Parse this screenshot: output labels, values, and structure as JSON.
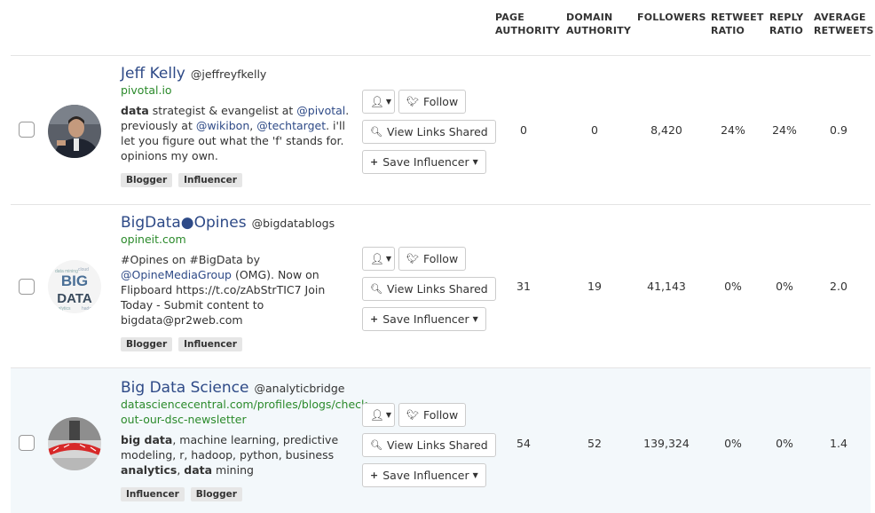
{
  "columns": {
    "page_authority": [
      "PAGE",
      "AUTHORITY"
    ],
    "domain_authority": [
      "DOMAIN",
      "AUTHORITY"
    ],
    "followers": [
      "FOLLOWERS"
    ],
    "retweet_ratio": [
      "RETWEET",
      "RATIO"
    ],
    "reply_ratio": [
      "REPLY",
      "RATIO"
    ],
    "average_retweets": [
      "AVERAGE",
      "RETWEETS"
    ]
  },
  "buttons": {
    "follow": "Follow",
    "view_links": "View Links Shared",
    "save": "Save Influencer"
  },
  "influencers": [
    {
      "name": "Jeff Kelly",
      "handle": "@jeffreyfkelly",
      "site": [
        "pivotal.io"
      ],
      "bio": [
        [
          {
            "t": "data",
            "b": true
          },
          {
            "t": " strategist & evangelist at "
          },
          {
            "t": "@pivotal",
            "m": true
          },
          {
            "t": "."
          }
        ],
        [
          {
            "t": "previously at "
          },
          {
            "t": "@wikibon",
            "m": true
          },
          {
            "t": ", "
          },
          {
            "t": "@techtarget",
            "m": true
          },
          {
            "t": ". i'll"
          }
        ],
        [
          {
            "t": "let you figure out what the 'f' stands for."
          }
        ],
        [
          {
            "t": "opinions my own."
          }
        ]
      ],
      "tags": [
        "Blogger",
        "Influencer"
      ],
      "page_authority": "0",
      "domain_authority": "0",
      "followers": "8,420",
      "retweet_ratio": "24%",
      "reply_ratio": "24%",
      "average_retweets": "0.9"
    },
    {
      "name": "BigData●Opines",
      "handle": "@bigdatablogs",
      "site": [
        "opineit.com"
      ],
      "bio": [
        [
          {
            "t": "#Opines on #BigData by"
          }
        ],
        [
          {
            "t": "@OpineMediaGroup",
            "m": true
          },
          {
            "t": " (OMG). Now on"
          }
        ],
        [
          {
            "t": "Flipboard https://t.co/zAbStrTIC7 Join"
          }
        ],
        [
          {
            "t": "Today - Submit content to"
          }
        ],
        [
          {
            "t": "bigdata@pr2web.com"
          }
        ]
      ],
      "tags": [
        "Blogger",
        "Influencer"
      ],
      "page_authority": "31",
      "domain_authority": "19",
      "followers": "41,143",
      "retweet_ratio": "0%",
      "reply_ratio": "0%",
      "average_retweets": "2.0"
    },
    {
      "name": "Big Data Science",
      "handle": "@analyticbridge",
      "site": [
        "datasciencecentral.com/profiles/blogs/check-",
        "out-our-dsc-newsletter"
      ],
      "bio": [
        [
          {
            "t": "big data",
            "b": true
          },
          {
            "t": ", machine learning, predictive"
          }
        ],
        [
          {
            "t": "modeling, r, hadoop, python, business"
          }
        ],
        [
          {
            "t": "analytics",
            "b": true
          },
          {
            "t": ", "
          },
          {
            "t": "data",
            "b": true
          },
          {
            "t": " mining"
          }
        ]
      ],
      "tags": [
        "Influencer",
        "Blogger"
      ],
      "page_authority": "54",
      "domain_authority": "52",
      "followers": "139,324",
      "retweet_ratio": "0%",
      "reply_ratio": "0%",
      "average_retweets": "1.4"
    }
  ]
}
